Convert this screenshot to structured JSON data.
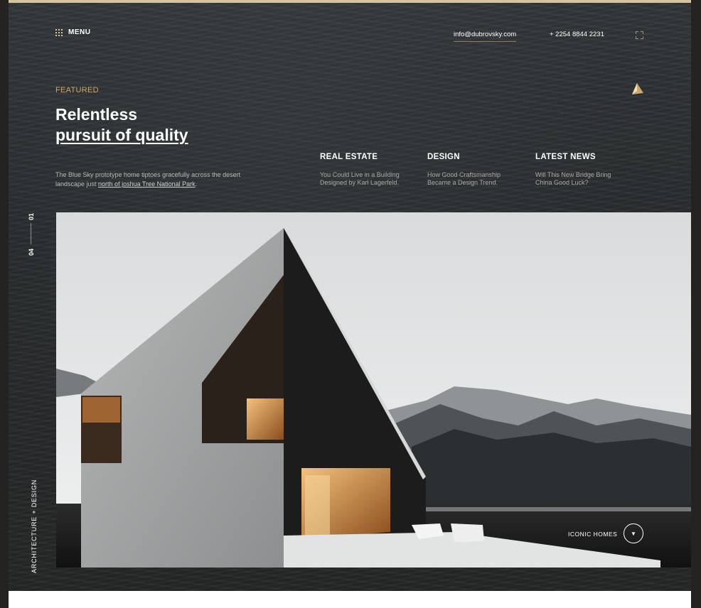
{
  "header": {
    "menu_label": "MENU",
    "email": "info@dubrovsky.com",
    "phone": "+ 2254 8844 2231"
  },
  "featured": {
    "kicker": "FEATURED",
    "title_line1": "Relentless",
    "title_line2": "pursuit of quality",
    "intro_text": "The Blue Sky prototype home tiptoes gracefully across the desert landscape just ",
    "intro_link": "north of joshua Tree National Park",
    "intro_end": "."
  },
  "categories": [
    {
      "title": "REAL ESTATE",
      "text": "You Could Live in a Building Designed by Karl Lagerfeld."
    },
    {
      "title": "DESIGN",
      "text": "How Good Craftsmanship Became a Design Trend."
    },
    {
      "title": "LATEST NEWS",
      "text": "Will This New Bridge Bring China Good Luck?"
    }
  ],
  "slider": {
    "current": "01",
    "total": "04",
    "side_label": "ARCHITECTURE + DESIGN",
    "hero_label": "ICONIC HOMES",
    "hero_button_glyph": "▼"
  },
  "colors": {
    "accent": "#c8a86b",
    "top_strip": "#d8c3a0"
  }
}
